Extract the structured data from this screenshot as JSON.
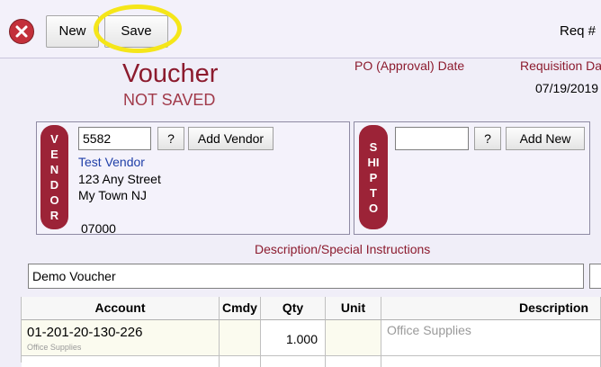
{
  "toolbar": {
    "close_icon": "close-circle-icon",
    "new_label": "New",
    "save_label": "Save",
    "req_label": "Req #",
    "highlight_color": "#f5e619"
  },
  "header": {
    "title": "Voucher",
    "status": "NOT SAVED",
    "po_label": "PO (Approval) Date",
    "req_date_label": "Requisition Da",
    "req_date_value": "07/19/2019"
  },
  "vendor": {
    "pill_label": "VENDOR",
    "id": "5582",
    "lookup_label": "?",
    "add_label": "Add Vendor",
    "name": "Test Vendor",
    "address1": "123 Any Street",
    "city_state": "My Town NJ",
    "zip": "07000"
  },
  "ship_to": {
    "pill_label": "SHIP TO",
    "id": "",
    "lookup_label": "?",
    "add_label": "Add New"
  },
  "description": {
    "label": "Description/Special Instructions",
    "value": "Demo Voucher"
  },
  "grid": {
    "columns": [
      "Account",
      "Cmdy",
      "Qty",
      "Unit",
      "Description"
    ],
    "rows": [
      {
        "account": "01-201-20-130-226",
        "account_sub": "Office Supplies",
        "cmdy": "",
        "qty": "1.000",
        "unit": "",
        "description": "Office Supplies"
      }
    ]
  },
  "colors": {
    "accent": "#8c1b2e",
    "pill": "#9c2337",
    "link": "#1f3fa8",
    "background": "#f0eef8"
  }
}
